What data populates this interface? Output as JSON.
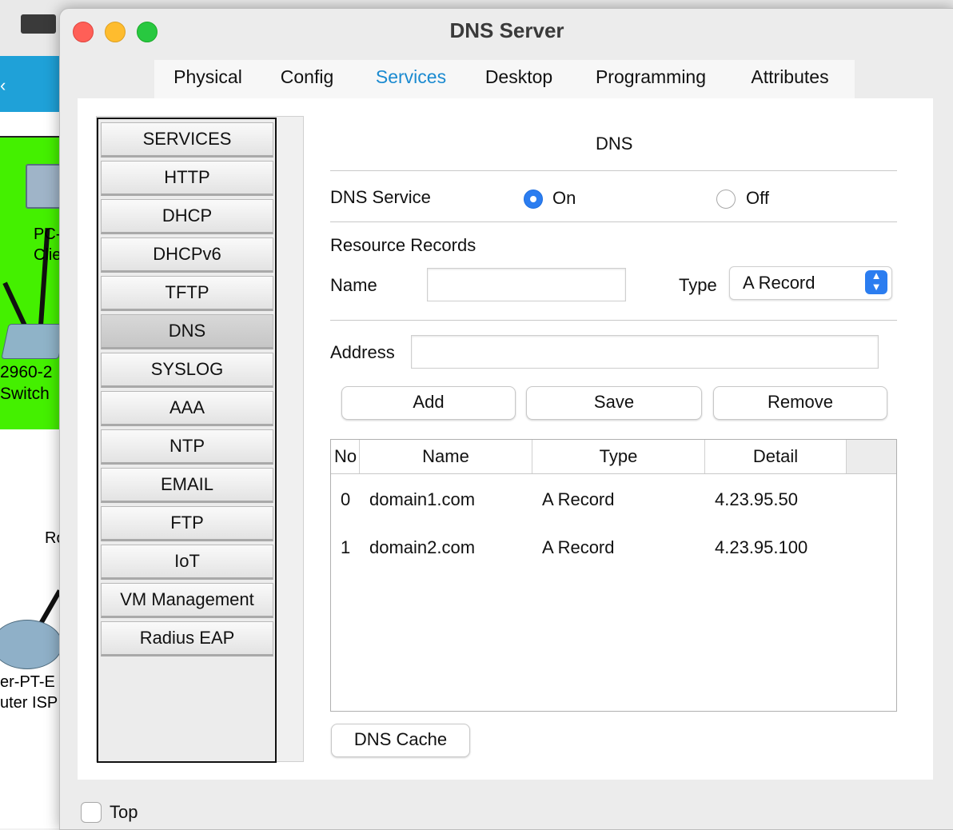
{
  "background_app": {
    "device_pc_label": "PC-\nClie",
    "device_switch_label": "2960-2\nSwitch",
    "device_router_partial": "Ro",
    "device_router_label": "er-PT-E\nuter ISP"
  },
  "window": {
    "title": "DNS Server"
  },
  "tabs": [
    {
      "label": "Physical"
    },
    {
      "label": "Config"
    },
    {
      "label": "Services",
      "active": true
    },
    {
      "label": "Desktop"
    },
    {
      "label": "Programming"
    },
    {
      "label": "Attributes"
    }
  ],
  "services_list": [
    {
      "label": "SERVICES"
    },
    {
      "label": "HTTP"
    },
    {
      "label": "DHCP"
    },
    {
      "label": "DHCPv6"
    },
    {
      "label": "TFTP"
    },
    {
      "label": "DNS",
      "active": true
    },
    {
      "label": "SYSLOG"
    },
    {
      "label": "AAA"
    },
    {
      "label": "NTP"
    },
    {
      "label": "EMAIL"
    },
    {
      "label": "FTP"
    },
    {
      "label": "IoT"
    },
    {
      "label": "VM Management"
    },
    {
      "label": "Radius EAP"
    }
  ],
  "dns": {
    "section_title": "DNS",
    "service_label": "DNS Service",
    "on_label": "On",
    "off_label": "Off",
    "service_state": "On",
    "resource_records_label": "Resource Records",
    "name_label": "Name",
    "name_value": "",
    "type_label": "Type",
    "type_value": "A Record",
    "address_label": "Address",
    "address_value": "",
    "add_label": "Add",
    "save_label": "Save",
    "remove_label": "Remove",
    "cache_label": "DNS Cache"
  },
  "records_table": {
    "columns": [
      "No",
      "Name",
      "Type",
      "Detail"
    ],
    "rows": [
      {
        "no": "0",
        "name": "domain1.com",
        "type": "A Record",
        "detail": "4.23.95.50"
      },
      {
        "no": "1",
        "name": "domain2.com",
        "type": "A Record",
        "detail": "4.23.95.100"
      }
    ]
  },
  "footer": {
    "top_label": "Top",
    "top_checked": false
  },
  "colors": {
    "accent": "#1a8ad0",
    "radio_selected": "#2b7df0",
    "canvas_green": "#44f000"
  }
}
